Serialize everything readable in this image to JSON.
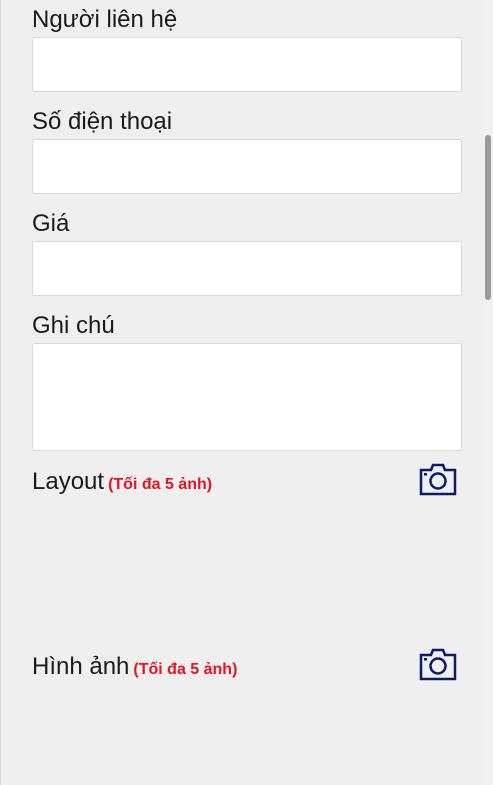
{
  "form": {
    "contact_label": "Người liên hệ",
    "contact_value": "",
    "phone_label": "Số điện thoại",
    "phone_value": "",
    "price_label": "Giá",
    "price_value": "",
    "note_label": "Ghi chú",
    "note_value": ""
  },
  "uploads": {
    "layout": {
      "title": "Layout",
      "hint": "(Tối đa 5 ảnh)",
      "icon": "camera-icon"
    },
    "images": {
      "title": "Hình ảnh",
      "hint": "(Tối đa 5 ảnh)",
      "icon": "camera-icon"
    }
  },
  "colors": {
    "background": "#efefef",
    "hint_red": "#e8141b",
    "icon_navy": "#0d1a6b"
  }
}
